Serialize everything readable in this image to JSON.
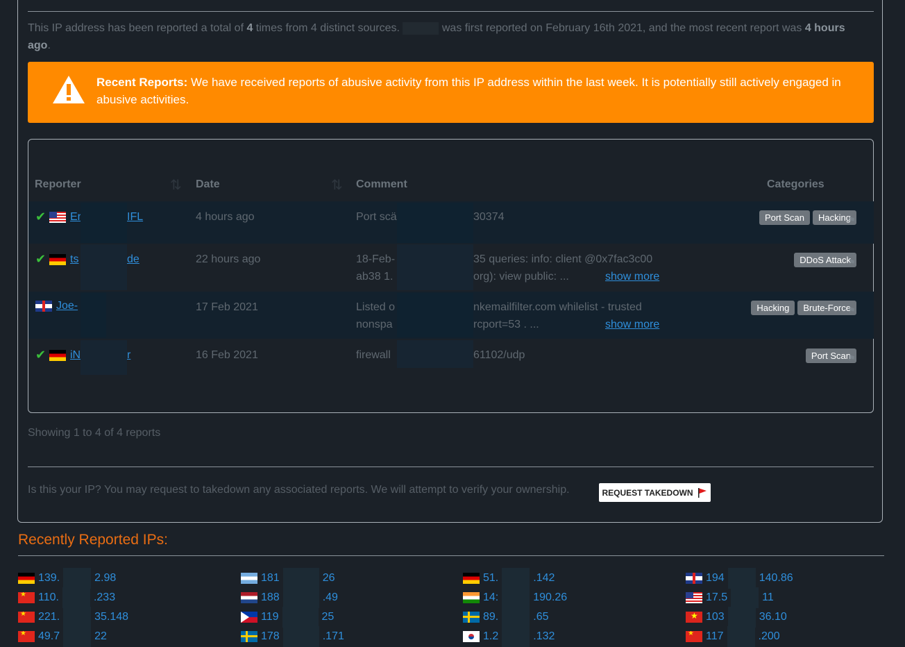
{
  "summary": {
    "part1": "This IP address has been reported a total of ",
    "count": "4",
    "part2": " times from 4 distinct sources. ",
    "part3": " was first reported on February 16th 2021, and the most recent report was ",
    "recent": "4 hours ago",
    "end": "."
  },
  "alert": {
    "title": "Recent Reports:",
    "text": " We have received reports of abusive activity from this IP address within the last week. It is potentially still actively engaged in abusive activities."
  },
  "table": {
    "headers": {
      "reporter": "Reporter",
      "date": "Date",
      "comment": "Comment",
      "categories": "Categories"
    },
    "rows": [
      {
        "verified": true,
        "flag": "us",
        "reporter": "Er IFL",
        "reporter_a": "Er",
        "reporter_b": "IFL",
        "date": "4 hours ago",
        "comment_1": "Port scä",
        "comment_1b": "30374",
        "comment_2": "",
        "comment_2b": "",
        "show_more": "",
        "categories": [
          "Port Scan",
          "Hacking"
        ]
      },
      {
        "verified": true,
        "flag": "de",
        "reporter": "ts de",
        "reporter_a": "ts",
        "reporter_b": "de",
        "date": "22 hours ago",
        "comment_1": "18-Feb-",
        "comment_1b": "35 queries: info: client @0x7fac3c00",
        "comment_2": "ab38 1.",
        "comment_2b": "org): view public: ...",
        "show_more": "show more",
        "categories": [
          "DDoS Attack"
        ]
      },
      {
        "verified": false,
        "flag": "gb",
        "reporter": "Joe-",
        "reporter_a": "Joe-",
        "reporter_b": "",
        "date": "17 Feb 2021",
        "comment_1": "Listed o",
        "comment_1b": "nkemailfilter.com whilelist - trusted",
        "comment_2": "nonspa",
        "comment_2b": "rcport=53 . ...",
        "show_more": "show more",
        "categories": [
          "Hacking",
          "Brute-Force"
        ]
      },
      {
        "verified": true,
        "flag": "de",
        "reporter": "iN r",
        "reporter_a": "iN",
        "reporter_b": "r",
        "date": "16 Feb 2021",
        "comment_1": "firewall",
        "comment_1b": "61102/udp",
        "comment_2": "",
        "comment_2b": "",
        "show_more": "",
        "categories": [
          "Port Scan"
        ]
      }
    ]
  },
  "showing": "Showing 1 to 4 of 4 reports",
  "takedown": {
    "text": "Is this your IP? You may request to takedown any associated reports. We will attempt to verify your ownership.",
    "button": "REQUEST TAKEDOWN"
  },
  "recent": {
    "title": "Recently Reported IPs:",
    "ips": [
      {
        "flag": "de",
        "a": "139.",
        "b": "2.98"
      },
      {
        "flag": "cn",
        "a": "110.",
        "b": ".233"
      },
      {
        "flag": "cn",
        "a": "221.",
        "b": "35.148"
      },
      {
        "flag": "cn",
        "a": "49.7",
        "b": "22"
      },
      {
        "flag": "ar",
        "a": "181",
        "b": "26"
      },
      {
        "flag": "nl",
        "a": "188",
        "b": ".49"
      },
      {
        "flag": "ph",
        "a": "119",
        "b": "25"
      },
      {
        "flag": "se",
        "a": "178",
        "b": ".171"
      },
      {
        "flag": "de",
        "a": "51.",
        "b": ".142"
      },
      {
        "flag": "in",
        "a": "14:",
        "b": "190.26"
      },
      {
        "flag": "se",
        "a": "89.",
        "b": ".65"
      },
      {
        "flag": "kr",
        "a": "1.2",
        "b": ".132"
      },
      {
        "flag": "gb",
        "a": "194",
        "b": "140.86"
      },
      {
        "flag": "us",
        "a": "17.5",
        "b": "11"
      },
      {
        "flag": "vn",
        "a": "103",
        "b": "36.10"
      },
      {
        "flag": "cn",
        "a": "117",
        "b": ".200"
      }
    ]
  }
}
